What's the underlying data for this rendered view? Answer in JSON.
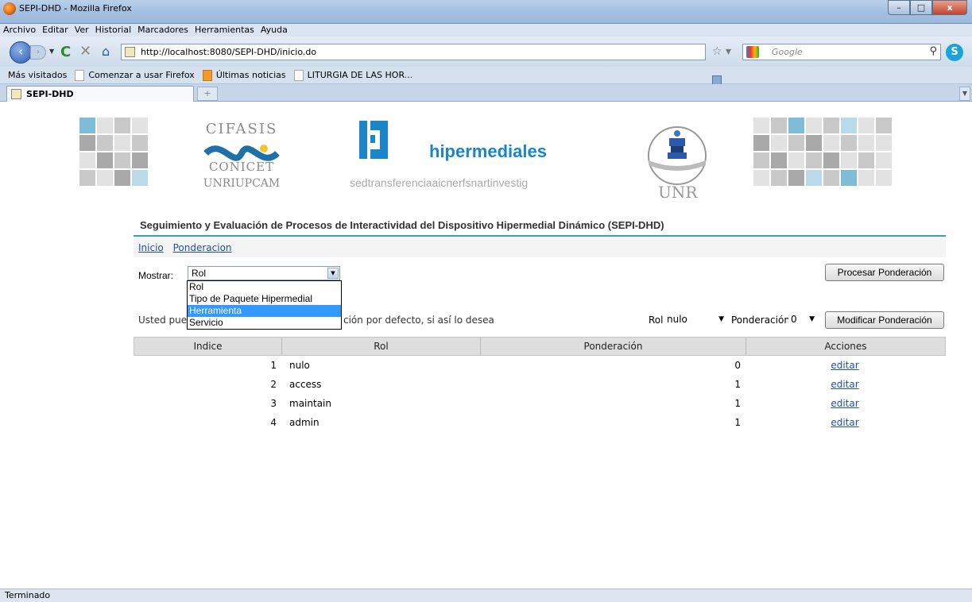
{
  "window": {
    "title": "SEPI-DHD - Mozilla Firefox",
    "buttons": {
      "minimize": "–",
      "maximize": "□",
      "close": "x"
    }
  },
  "menubar": [
    "Archivo",
    "Editar",
    "Ver",
    "Historial",
    "Marcadores",
    "Herramientas",
    "Ayuda"
  ],
  "navigation": {
    "url": "http://localhost:8080/SEPI-DHD/inicio.do",
    "search_placeholder": "Google"
  },
  "bookmarks": [
    {
      "label": "Más visitados",
      "icon": "star-folder-icon"
    },
    {
      "label": "Comenzar a usar Firefox",
      "icon": "page-icon"
    },
    {
      "label": "Últimas noticias",
      "icon": "rss-icon"
    },
    {
      "label": "LITURGIA DE LAS HOR...",
      "icon": "page-icon"
    }
  ],
  "tabs": [
    {
      "label": "SEPI-DHD"
    }
  ],
  "logos": {
    "cifasis_top": "CIFASIS",
    "cifasis_mid": "CONICET",
    "cifasis_bottom": "UNRIUPCAM",
    "hiper_title": "hipermediales",
    "hiper_sub": "sedtransferenciaaicnerfsnartinvestig",
    "unr": "UNR"
  },
  "page": {
    "title": "Seguimiento y Evaluación de Procesos de Interactividad del Dispositivo Hipermedial Dinámico (SEPI-DHD)",
    "nav_links": [
      "Inicio",
      "Ponderacion"
    ],
    "mostrar_label": "Mostrar:",
    "mostrar_value": "Rol",
    "dropdown_options": [
      "Rol",
      "Tipo de Paquete Hipermedial",
      "Herramienta",
      "Servicio"
    ],
    "dropdown_highlighted": "Herramienta",
    "procesar_button": "Procesar Ponderación",
    "info_left": "Usted pued",
    "info_right": "ción por defecto, si así lo desea",
    "rol_label": "Rol",
    "rol_value": "nulo",
    "ponderacion_label": "Ponderación",
    "ponderacion_value": "0",
    "modificar_button": "Modificar Ponderación"
  },
  "table": {
    "columns": [
      "Indice",
      "Rol",
      "Ponderación",
      "Acciones"
    ],
    "rows": [
      {
        "indice": "1",
        "rol": "nulo",
        "ponderacion": "0",
        "accion": "editar"
      },
      {
        "indice": "2",
        "rol": "access",
        "ponderacion": "1",
        "accion": "editar"
      },
      {
        "indice": "3",
        "rol": "maintain",
        "ponderacion": "1",
        "accion": "editar"
      },
      {
        "indice": "4",
        "rol": "admin",
        "ponderacion": "1",
        "accion": "editar"
      }
    ]
  },
  "status": "Terminado",
  "colors": {
    "accent": "#3c9dc4",
    "link": "#1f4fa4",
    "highlight": "#3399ff",
    "brand_blue": "#1a85c9"
  }
}
